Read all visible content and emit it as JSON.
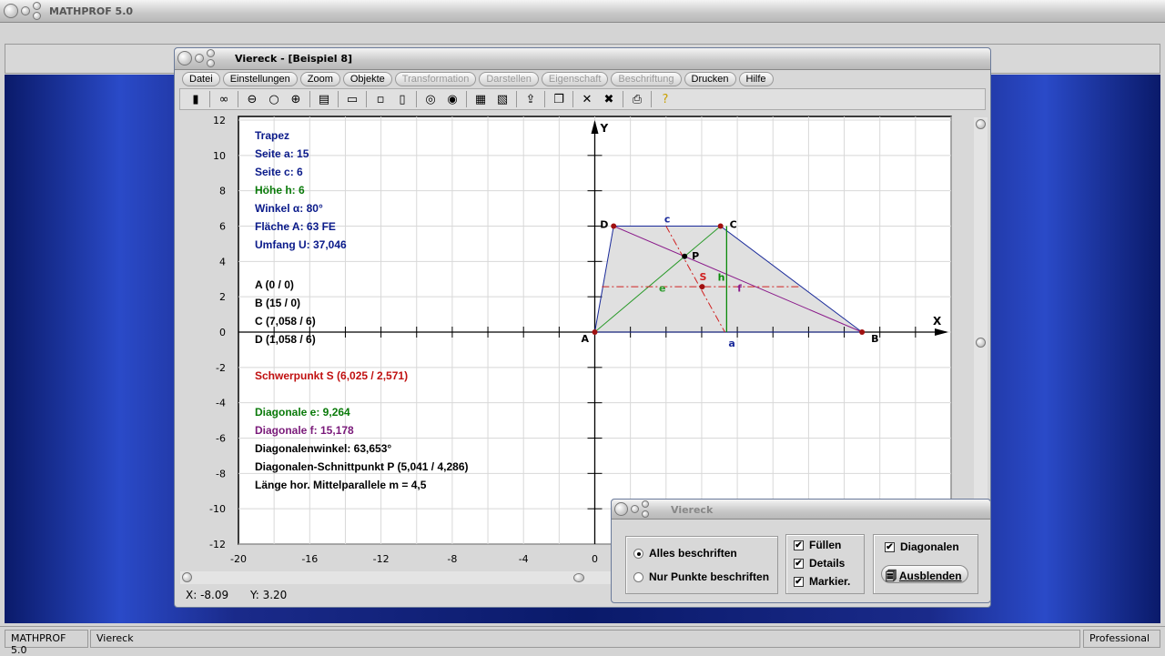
{
  "app": {
    "title": "MATHPROF 5.0"
  },
  "window": {
    "title": "Viereck - [Beispiel 8]"
  },
  "menu": [
    {
      "label": "Datei",
      "enabled": true
    },
    {
      "label": "Einstellungen",
      "enabled": true
    },
    {
      "label": "Zoom",
      "enabled": true
    },
    {
      "label": "Objekte",
      "enabled": true
    },
    {
      "label": "Transformation",
      "enabled": false
    },
    {
      "label": "Darstellen",
      "enabled": false
    },
    {
      "label": "Eigenschaft",
      "enabled": false
    },
    {
      "label": "Beschriftung",
      "enabled": false
    },
    {
      "label": "Drucken",
      "enabled": true
    },
    {
      "label": "Hilfe",
      "enabled": true
    }
  ],
  "toolbar_icons": [
    "exit-icon",
    "glasses-icon",
    "zoom-out-icon",
    "zoom-reset-icon",
    "zoom-in-icon",
    "properties-icon",
    "window-icon",
    "small-box-icon",
    "double-box-icon",
    "circle-1-icon",
    "circle-2-icon",
    "table-icon",
    "graph-icon",
    "export-icon",
    "copy-icon",
    "erase-icon",
    "erase-all-icon",
    "print-icon",
    "help-icon"
  ],
  "info": {
    "title": "Trapez",
    "seite_a": "Seite a: 15",
    "seite_c": "Seite c: 6",
    "hoehe": "Höhe h: 6",
    "winkel": "Winkel  α:  80°",
    "flaeche": "Fläche A: 63 FE",
    "umfang": "Umfang U: 37,046",
    "A": "A (0 / 0)",
    "B": "B (15 / 0)",
    "C": "C (7,058 / 6)",
    "D": "D (1,058 / 6)",
    "schwerpunkt": "Schwerpunkt S (6,025 / 2,571)",
    "diag_e": "Diagonale e: 9,264",
    "diag_f": "Diagonale f: 15,178",
    "diag_winkel": "Diagonalenwinkel: 63,653°",
    "schnittpunkt": "Diagonalen-Schnittpunkt P (5,041 / 4,286)",
    "mittelparallele": "Länge hor. Mittelparallele m = 4,5"
  },
  "plot": {
    "xlim": [
      -20,
      20
    ],
    "ylim": [
      -12,
      12
    ],
    "grid": true,
    "axis_x_label": "X",
    "axis_y_label": "Y",
    "x_ticks": [
      "-20",
      "-16",
      "-12",
      "-8",
      "-4",
      "0"
    ],
    "y_ticks": [
      "12",
      "10",
      "8",
      "6",
      "4",
      "2",
      "0",
      "-2",
      "-4",
      "-6",
      "-8",
      "-10",
      "-12"
    ],
    "points": {
      "A": [
        0,
        0
      ],
      "B": [
        15,
        0
      ],
      "C": [
        7.058,
        6
      ],
      "D": [
        1.058,
        6
      ],
      "P": [
        5.041,
        4.286
      ],
      "S": [
        6.025,
        2.571
      ]
    },
    "labels": {
      "a": "a",
      "c": "c",
      "e": "e",
      "f": "f",
      "h": "h"
    },
    "colors": {
      "sides": "#1a2a9a",
      "diag_e": "#2a9a2a",
      "diag_f": "#8a1a8a",
      "height": "#0a8a0a",
      "midline": "#d02020",
      "fill": "#e0e0e0"
    }
  },
  "coords": {
    "x": "X: -8.09",
    "y": "Y: 3.20"
  },
  "dialog": {
    "title": "Viereck",
    "radio_all": "Alles beschriften",
    "radio_points": "Nur Punkte beschriften",
    "fill": "Füllen",
    "details": "Details",
    "mark": "Markier.",
    "diagonals": "Diagonalen",
    "hide": "Ausblenden"
  },
  "statusbar": {
    "app": "MATHPROF 5.0",
    "module": "Viereck",
    "edition": "Professional"
  }
}
